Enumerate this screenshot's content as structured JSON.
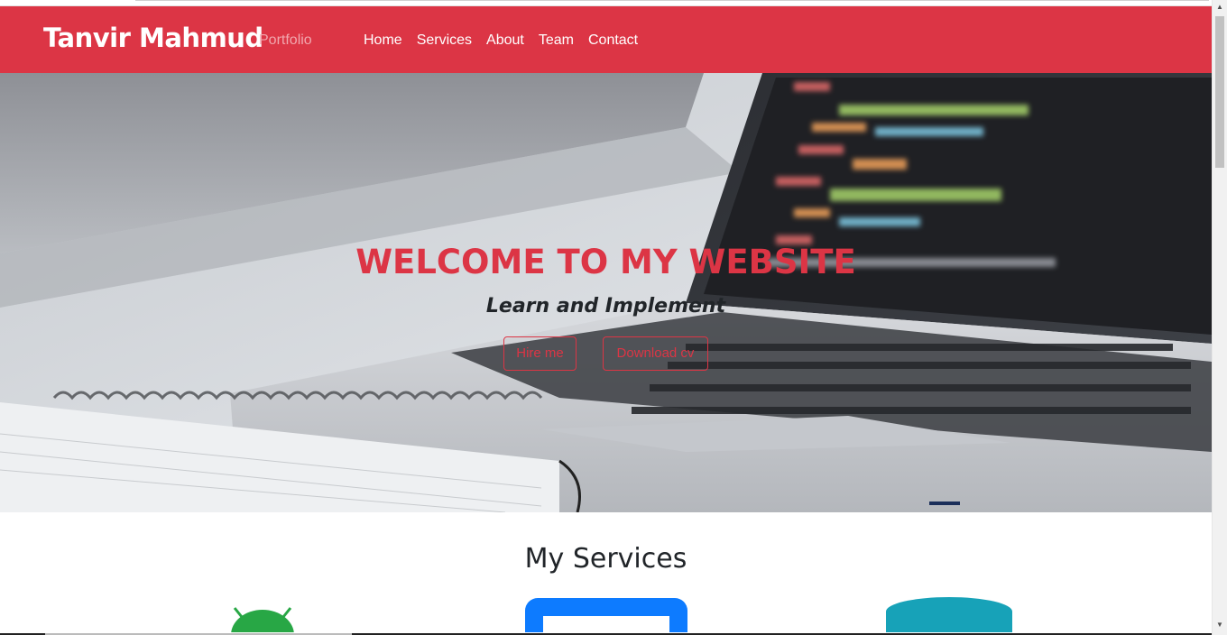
{
  "navbar": {
    "brand": "Tanvir Mahmud",
    "brand_sub": "Portfolio",
    "links": [
      "Home",
      "Services",
      "About",
      "Team",
      "Contact"
    ],
    "color": "#dc3545"
  },
  "hero": {
    "title": "WELCOME TO MY WEBSITE",
    "subtitle": "Learn and Implement",
    "hire_label": "Hire me",
    "cv_label": "Download cv",
    "background": "laptop-with-code-photo"
  },
  "services": {
    "title": "My Services",
    "icons": [
      "android-icon",
      "monitor-icon",
      "database-icon"
    ]
  }
}
